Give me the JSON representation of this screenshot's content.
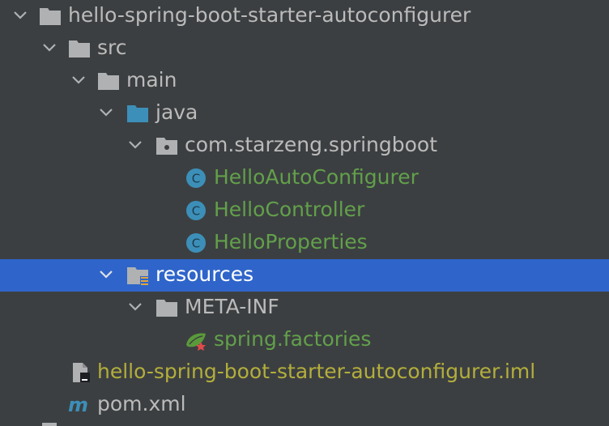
{
  "project_tree": {
    "items": [
      {
        "label": "hello-spring-boot-starter-autoconfigurer",
        "icon": "folder-icon",
        "expanded": true
      },
      {
        "label": "src",
        "icon": "folder-icon",
        "expanded": true
      },
      {
        "label": "main",
        "icon": "folder-icon",
        "expanded": true
      },
      {
        "label": "java",
        "icon": "source-root-folder-icon",
        "expanded": true
      },
      {
        "label": "com.starzeng.springboot",
        "icon": "package-icon",
        "expanded": true
      },
      {
        "label": "HelloAutoConfigurer",
        "icon": "class-icon"
      },
      {
        "label": "HelloController",
        "icon": "class-icon"
      },
      {
        "label": "HelloProperties",
        "icon": "class-icon"
      },
      {
        "label": "resources",
        "icon": "resources-root-folder-icon",
        "expanded": true,
        "selected": true
      },
      {
        "label": "META-INF",
        "icon": "folder-icon",
        "expanded": true
      },
      {
        "label": "spring.factories",
        "icon": "spring-icon"
      },
      {
        "label": "hello-spring-boot-starter-autoconfigurer.iml",
        "icon": "iml-file-icon"
      },
      {
        "label": "pom.xml",
        "icon": "maven-icon"
      }
    ]
  },
  "class_icon_letter": "C",
  "colors": {
    "background": "#3c3f41",
    "selection": "#2f65ca",
    "class_name": "#62a04b",
    "module_file": "#b3ae3c",
    "folder": "#afb1b3",
    "source_folder": "#3c8fb8",
    "class_badge": "#3c8fb8"
  }
}
